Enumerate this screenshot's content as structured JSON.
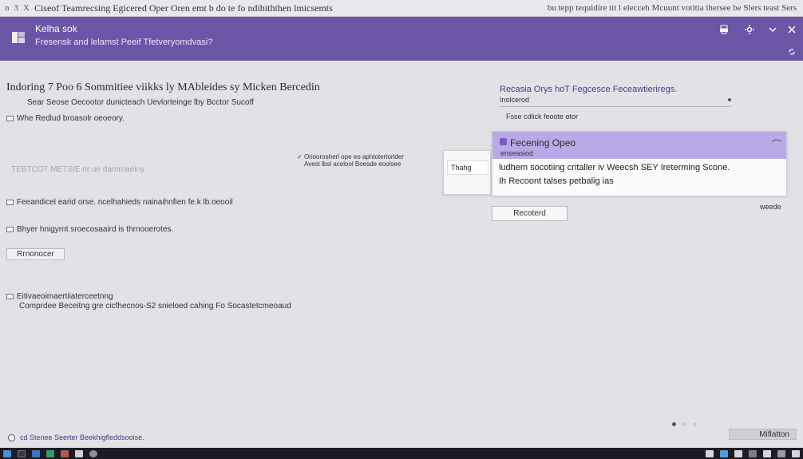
{
  "titlebar": {
    "nav_left": "n",
    "nav_mid": "3",
    "nav_right": "X",
    "title": "Ciseof Teamrecsing Egicered Oper Oren emt b do te fo ndihiththen lmicsemts",
    "right_text": "bu tepp tequidire tit l elecceh Mcuunt votitia ihersee be  Slers teast Sers"
  },
  "header": {
    "app_title": "Kelha sok",
    "app_subtitle": "Fresensk and lelamst Peeif Tfetveryomdvasi?",
    "accent": "#6a55a6",
    "icons": [
      "print-icon",
      "settings-icon",
      "chevron-down-icon",
      "close-icon",
      "sync-icon"
    ]
  },
  "main": {
    "heading": "Indoring 7 Poo 6 Sommitiee viikks ly MAbleides sy Micken Bercedin",
    "subheading": "Sear Seose Oecootor dunicteach Uevlorteinge lby Bcctor Sucoff",
    "option1": "Whe Redlud broasolr oeoeory.",
    "notice_line1": "Orioorosherl ope eo aphtotertorlder",
    "notice_line2": "Avest lbsl acelool Boesde eoolsee",
    "faded_line": "TEBTCOT METSIE nr ue damrnaeiny",
    "option2": "Feeandicel earid orse. ncelhahieds nainaihnfien fe.k lb.oeooil",
    "option3": "Bhyer hnigyrnt sroecosaaird is thrnooerotes.",
    "button_label": "Rrnonocer",
    "option4": "Eitivaeoimaertiiaterceetnng",
    "detail_line": "Comprdee Beceitng gre cicfhecnos-S2 snieloed cahing Fo Socastetcmeoaud"
  },
  "right_panel": {
    "title": "Recasia Orys hoT Fegcesce Feceawtieriregs.",
    "field_value": "Inolcerod",
    "note": "Fsse cdlick feoote otor",
    "popup_title": "Fecening Opeo",
    "popup_sub": "enseasiod",
    "popup_line1": "ludhem socotiing critaller iv Weecsh SEY Ireterming Scone.",
    "popup_line2": "Ih Recoont talses petbalig ias",
    "tooltip_text": "Thahg",
    "button_label": "Recoterd",
    "side_label": "weede"
  },
  "bottom": {
    "status_text": "cd  Stenee Seerter Beekhigfleddsooise.",
    "next_button": "Miflatton",
    "page_count": 3,
    "active_page": 1
  },
  "taskbar": {
    "left_icons": [
      "start-icon",
      "search-icon",
      "mail-icon",
      "files-icon",
      "photo-icon",
      "app-icon",
      "app-icon-2"
    ],
    "right_icons": [
      "tray-icon-1",
      "tray-icon-2",
      "tray-icon-3",
      "tray-icon-4",
      "tray-icon-5",
      "tray-icon-6",
      "tray-icon-7"
    ]
  }
}
